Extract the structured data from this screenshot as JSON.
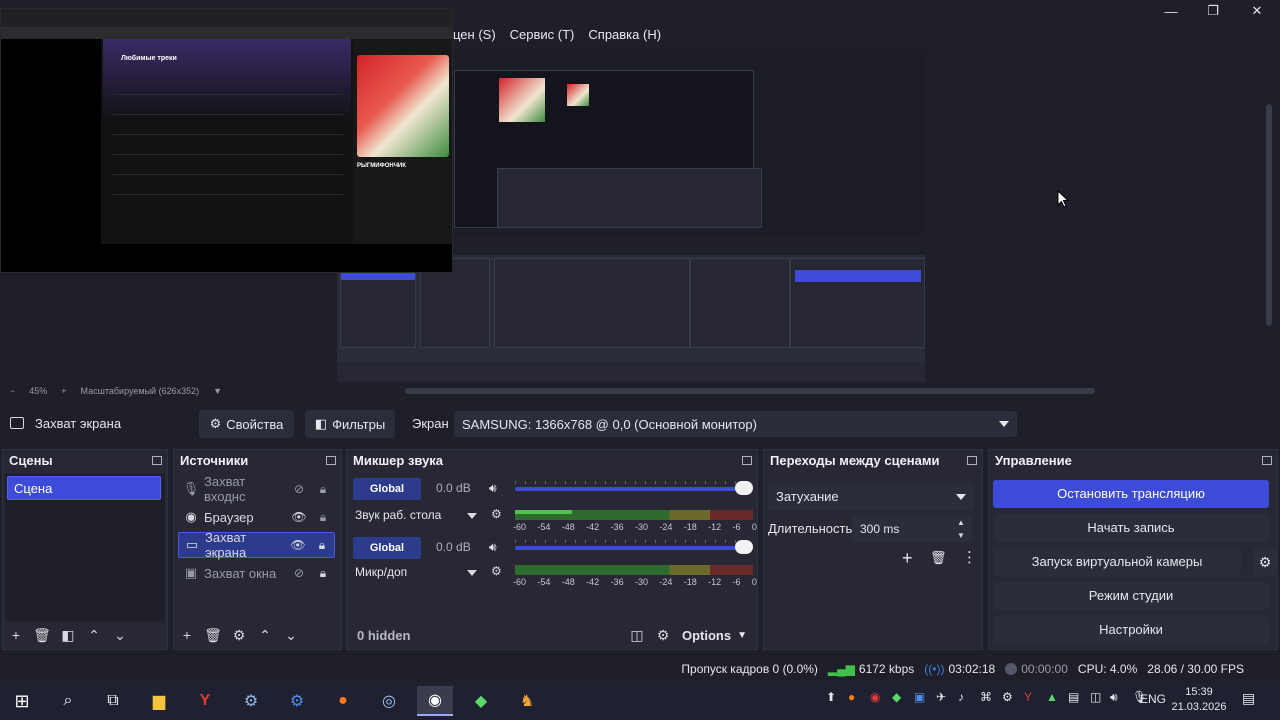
{
  "window": {
    "controls": [
      "—",
      "❐",
      "✕"
    ]
  },
  "menu": {
    "items": [
      "цен (S)",
      "Сервис (T)",
      "Справка (H)"
    ]
  },
  "preview": {
    "zoom": "45%",
    "scale_mode": "Масштабируемый (626x352)",
    "spotify_heading": "Любимые треки",
    "spotify_artist": "РЫГМИФОНЧИК"
  },
  "source_toolbar": {
    "source_name": "Захват экрана",
    "properties_label": "Свойства",
    "filters_label": "Фильтры",
    "screen_label": "Экран",
    "screen_value": "SAMSUNG: 1366x768 @ 0,0 (Основной монитор)"
  },
  "scenes": {
    "title": "Сцены",
    "items": [
      {
        "label": "Сцена",
        "active": true
      }
    ]
  },
  "sources": {
    "title": "Источники",
    "items": [
      {
        "label": "Захват входнс",
        "icon": "mic-icon",
        "visible": false,
        "dim": true
      },
      {
        "label": "Браузер",
        "icon": "globe-icon",
        "visible": true,
        "dim": false
      },
      {
        "label": "Захват экрана",
        "icon": "monitor-icon",
        "visible": true,
        "dim": false,
        "selected": true
      },
      {
        "label": "Захват окна",
        "icon": "window-icon",
        "visible": false,
        "dim": true
      }
    ]
  },
  "mixer": {
    "title": "Микшер звука",
    "channels": [
      {
        "badge": "Global",
        "db": "0.0 dB",
        "name": "Звук раб. стола",
        "level": 0.24
      },
      {
        "badge": "Global",
        "db": "0.0 dB",
        "name": "Микр/доп",
        "level": 0
      }
    ],
    "scale": [
      "-60",
      "-54",
      "-48",
      "-42",
      "-36",
      "-30",
      "-24",
      "-18",
      "-12",
      "-6",
      "0"
    ],
    "hidden_label": "0 hidden",
    "options_label": "Options"
  },
  "transitions": {
    "title": "Переходы между сценами",
    "selected": "Затухание",
    "duration_label": "Длительность",
    "duration_value": "300 ms"
  },
  "controls": {
    "title": "Управление",
    "buttons": [
      "Остановить трансляцию",
      "Начать запись",
      "Запуск виртуальной камеры",
      "Режим студии",
      "Настройки"
    ]
  },
  "status": {
    "dropped": "Пропуск кадров 0 (0.0%)",
    "bitrate": "6172 kbps",
    "stream_time": "03:02:18",
    "rec_time": "00:00:00",
    "cpu": "CPU: 4.0%",
    "fps": "28.06 / 30.00 FPS"
  },
  "taskbar": {
    "lang": "ENG",
    "time": "15:39",
    "date": "21.03.2026"
  },
  "colors": {
    "accent": "#3c4bd8",
    "panel": "#272834",
    "bg": "#1e1f29"
  }
}
